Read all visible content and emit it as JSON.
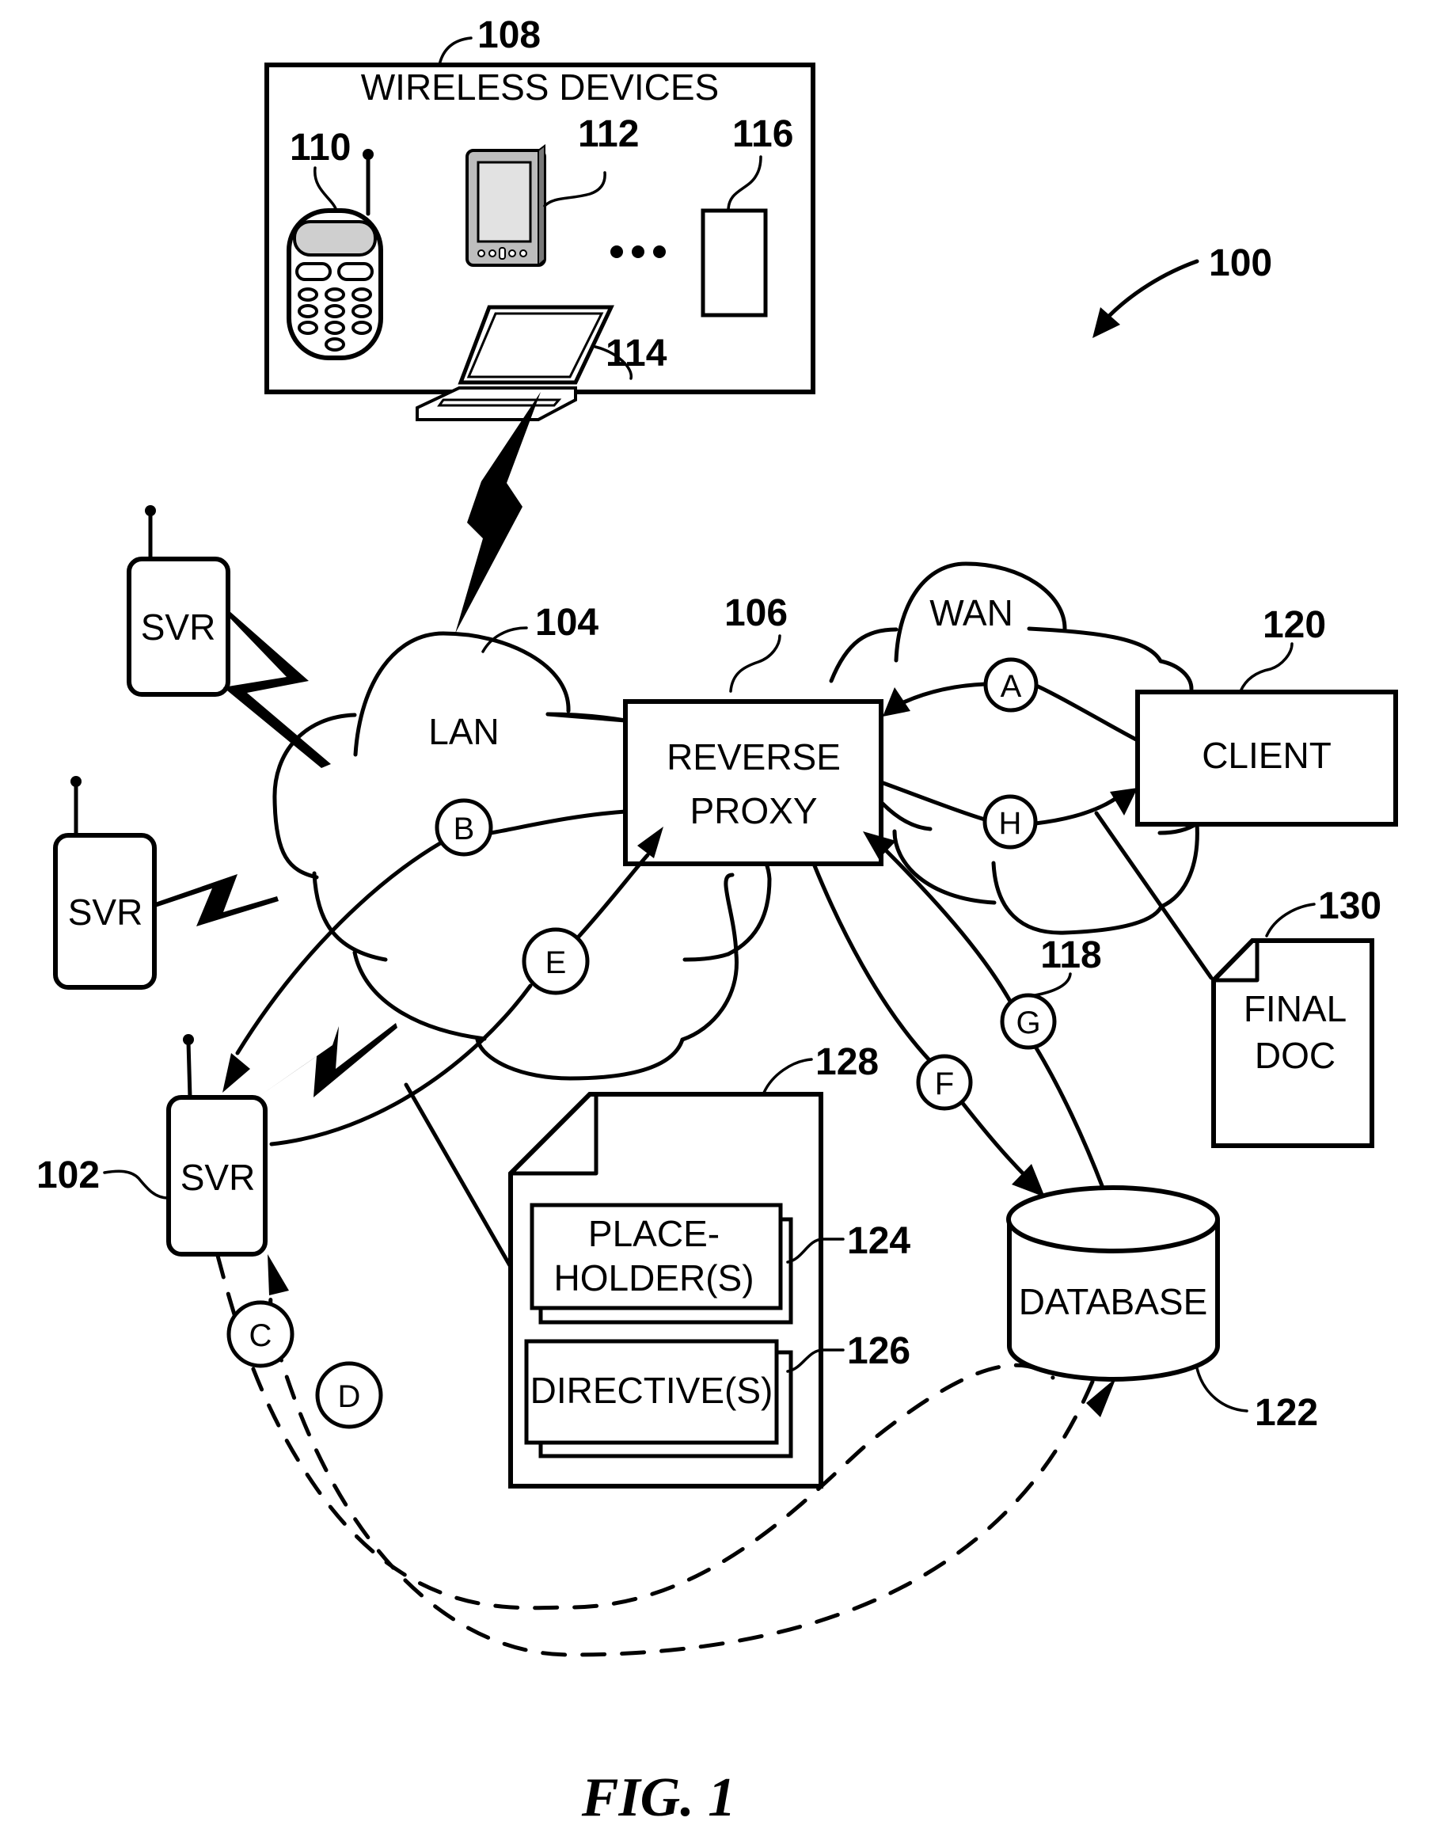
{
  "figure": {
    "caption": "FIG. 1",
    "system_ref": "100"
  },
  "wireless_devices": {
    "title": "WIRELESS DEVICES",
    "ref": "108",
    "phone_ref": "110",
    "pda_ref": "112",
    "laptop_ref": "114",
    "other_ref": "116",
    "ellipsis": "•••"
  },
  "networks": {
    "lan": {
      "label": "LAN",
      "ref": "104"
    },
    "wan": {
      "label": "WAN"
    }
  },
  "nodes": {
    "reverse_proxy": {
      "line1": "REVERSE",
      "line2": "PROXY",
      "ref": "106"
    },
    "client": {
      "label": "CLIENT",
      "ref": "120"
    },
    "server_main": {
      "label": "SVR",
      "ref": "102"
    },
    "server_a": {
      "label": "SVR"
    },
    "server_b": {
      "label": "SVR"
    },
    "database": {
      "label": "DATABASE",
      "ref": "122"
    },
    "final_doc": {
      "line1": "FINAL",
      "line2": "DOC",
      "ref": "130"
    },
    "template_doc": {
      "ref": "128",
      "placeholder_line1": "PLACE-",
      "placeholder_line2": "HOLDER(S)",
      "placeholder_ref": "124",
      "directive": "DIRECTIVE(S)",
      "directive_ref": "126"
    }
  },
  "flow_steps": [
    "A",
    "B",
    "C",
    "D",
    "E",
    "F",
    "G",
    "H"
  ],
  "link_ref": "118"
}
